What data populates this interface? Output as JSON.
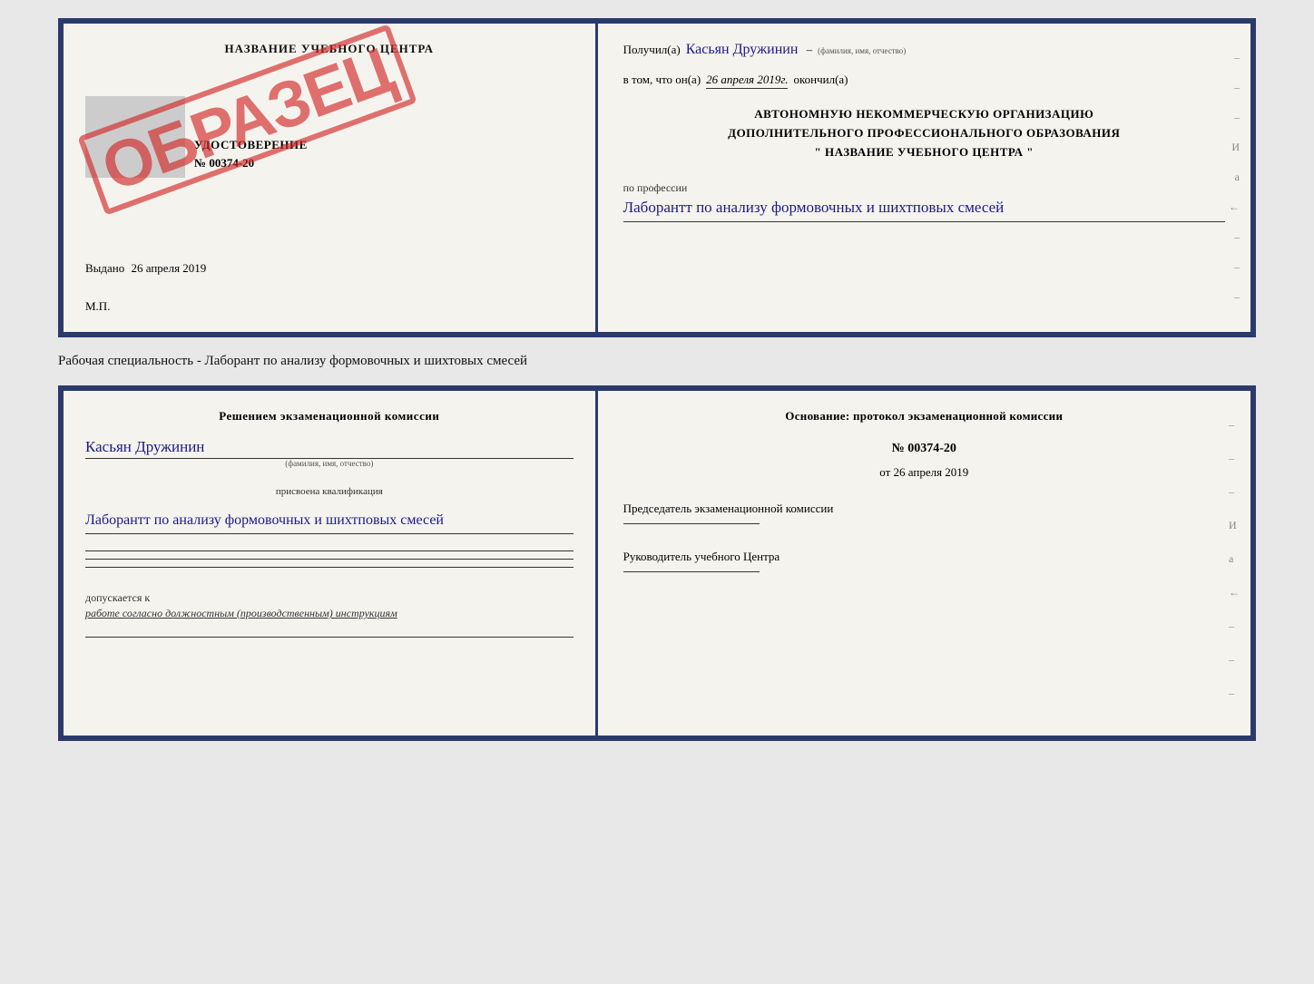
{
  "page": {
    "bg_color": "#e8e8e8"
  },
  "top_doc": {
    "left": {
      "title": "НАЗВАНИЕ УЧЕБНОГО ЦЕНТРА",
      "stamp_text": "ОБРАЗЕЦ",
      "udost_label": "УДОСТОВЕРЕНИЕ",
      "udost_number": "№ 00374-20",
      "vydano_label": "Выдано",
      "vydano_date": "26 апреля 2019",
      "mp_label": "М.П."
    },
    "right": {
      "poluchil_label": "Получил(а)",
      "recipient_name": "Касьян Дружинин",
      "fio_small": "(фамилия, имя, отчество)",
      "vtom_label": "в том, что он(а)",
      "vtom_date": "26 апреля 2019г.",
      "okonchil_label": "окончил(а)",
      "center_line1": "АВТОНОМНУЮ НЕКОММЕРЧЕСКУЮ ОРГАНИЗАЦИЮ",
      "center_line2": "ДОПОЛНИТЕЛЬНОГО ПРОФЕССИОНАЛЬНОГО ОБРАЗОВАНИЯ",
      "center_line3": "\"   НАЗВАНИЕ УЧЕБНОГО ЦЕНТРА   \"",
      "po_professii_label": "по профессии",
      "profession": "Лаборантт по анализу формовочных и шихтповых смесей",
      "dashes": [
        "-",
        "-",
        "-",
        "И",
        "а",
        "←",
        "-",
        "-",
        "-"
      ]
    }
  },
  "subtitle": "Рабочая специальность - Лаборант по анализу формовочных и шихтовых смесей",
  "bottom_doc": {
    "left": {
      "resheniem_label": "Решением экзаменационной комиссии",
      "name": "Касьян Дружинин",
      "fio_small": "(фамилия, имя, отчество)",
      "prisvoena_label": "присвоена квалификация",
      "profession": "Лаборантт по анализу формовочных и шихтповых смесей",
      "dopusk_label": "допускается к",
      "dopusk_text": "работе согласно должностным (производственным) инструкциям"
    },
    "right": {
      "osnovanie_label": "Основание: протокол экзаменационной комиссии",
      "number_label": "№ 00374-20",
      "ot_label": "от",
      "ot_date": "26 апреля 2019",
      "predsedatel_label": "Председатель экзаменационной комиссии",
      "rukovoditel_label": "Руководитель учебного Центра",
      "dashes": [
        "-",
        "-",
        "-",
        "И",
        "а",
        "←",
        "-",
        "-",
        "-"
      ]
    }
  }
}
